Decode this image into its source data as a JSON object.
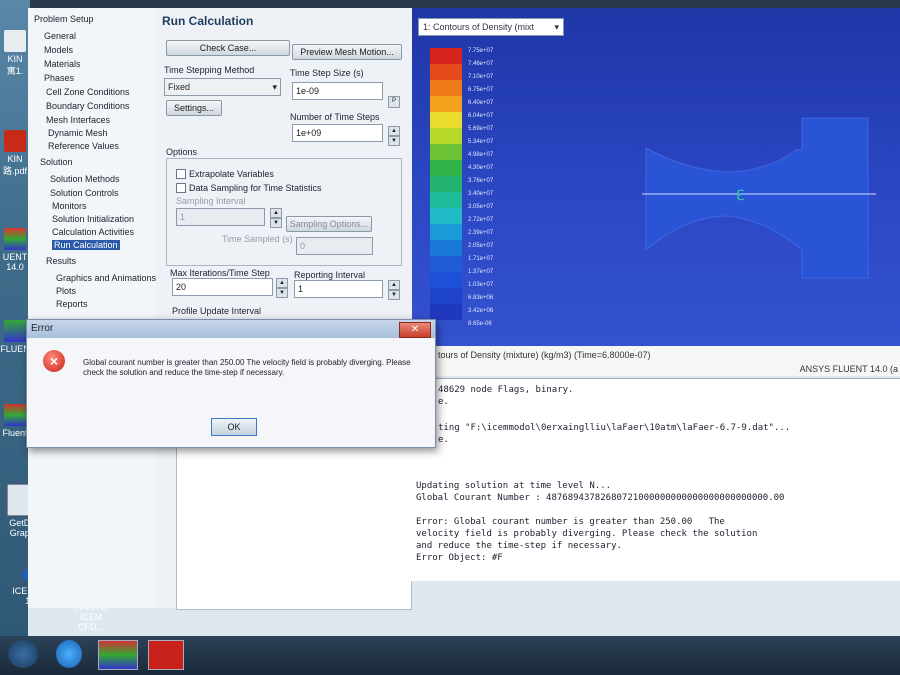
{
  "tree": {
    "problem_setup": "Problem Setup",
    "items": [
      "General",
      "Models",
      "Materials",
      "Phases",
      "Cell Zone Conditions",
      "Boundary Conditions",
      "Mesh Interfaces",
      "Dynamic Mesh",
      "Reference Values"
    ],
    "solution": "Solution",
    "solution_items": [
      "Solution Methods",
      "Solution Controls",
      "Monitors",
      "Solution Initialization",
      "Calculation Activities",
      "Run Calculation"
    ],
    "results": "Results",
    "results_items": [
      "Graphics and Animations",
      "Plots",
      "Reports"
    ]
  },
  "panel": {
    "title": "Run Calculation",
    "check_case": "Check Case...",
    "preview_mesh": "Preview Mesh Motion...",
    "time_stepping_label": "Time Stepping Method",
    "time_stepping_value": "Fixed",
    "time_step_size_label": "Time Step Size (s)",
    "time_step_size_value": "1e-09",
    "settings_button": "Settings...",
    "num_time_steps_label": "Number of Time Steps",
    "num_time_steps_value": "1e+09",
    "options_label": "Options",
    "extrapolate": "Extrapolate Variables",
    "data_sampling": "Data Sampling for Time Statistics",
    "sampling_interval_label": "Sampling Interval",
    "sampling_interval_value": "1",
    "sampling_options": "Sampling Options...",
    "time_sampled_label": "Time Sampled (s)",
    "time_sampled_value": "0",
    "max_iter_label": "Max Iterations/Time Step",
    "max_iter_value": "20",
    "reporting_label": "Reporting Interval",
    "reporting_value": "1",
    "profile_label": "Profile Update Interval"
  },
  "graphics": {
    "tab": "1: Contours of Density (mixt",
    "ticks": [
      "7.75e+07",
      "7.46e+07",
      "7.10e+07",
      "6.75e+07",
      "6.40e+07",
      "6.04e+07",
      "5.69e+07",
      "5.34e+07",
      "4.98e+07",
      "4.30e+07",
      "3.76e+07",
      "3.40e+07",
      "3.05e+07",
      "2.72e+07",
      "2.39e+07",
      "2.05e+07",
      "1.71e+07",
      "1.37e+07",
      "1.03e+07",
      "6.83e+06",
      "3.42e+06",
      "8.65e-06"
    ],
    "footer_left": "tours of Density (mixture)  (kg/m3)  (Time=6.8000e-07)",
    "footer_right": "ANSYS FLUENT 14.0 (a",
    "colors": {
      "red": "#d8231c",
      "orange": "#ef7a1a",
      "yellow": "#e9dc2c",
      "green": "#2fb34a",
      "cyan": "#1fbcc8",
      "blue": "#1e4fd8",
      "mesh": "#2a54d6"
    }
  },
  "console": {
    "l1": "48629 node Flags, binary.",
    "l2": "e.",
    "l3": "ting \"F:\\icemmodol\\0erxainglliu\\laFaer\\10atm\\laFaer-6.7-9.dat\"...",
    "l4": "e.",
    "l5": "Updating solution at time level N...",
    "l6": "Global Courant Number : 48768943782680721000000000000000000000000.00",
    "l7": "Error: Global courant number is greater than 250.00   The",
    "l8": "velocity field is probably diverging. Please check the solution",
    "l9": "and reduce the time-step if necessary.",
    "l10": "Error Object: #F"
  },
  "dialog": {
    "title": "Error",
    "close": "✕",
    "message": "Global courant number is greater than 250.00   The velocity field is probably diverging. Please check the solution and reduce the time-step if necessary.",
    "ok": "OK"
  },
  "desktop": {
    "kin": "KIN",
    "doc1": "寓1.",
    "kin2": "KIN",
    "pdf": "路.pdf",
    "uent": "UENT 14.0",
    "fluent": "FLUEN",
    "fluent2": "Fluent",
    "getdata": "GetData Graph...",
    "icem": "ICEM CFD 14.0",
    "ansys": "ANSYS ICEM CFD..."
  }
}
